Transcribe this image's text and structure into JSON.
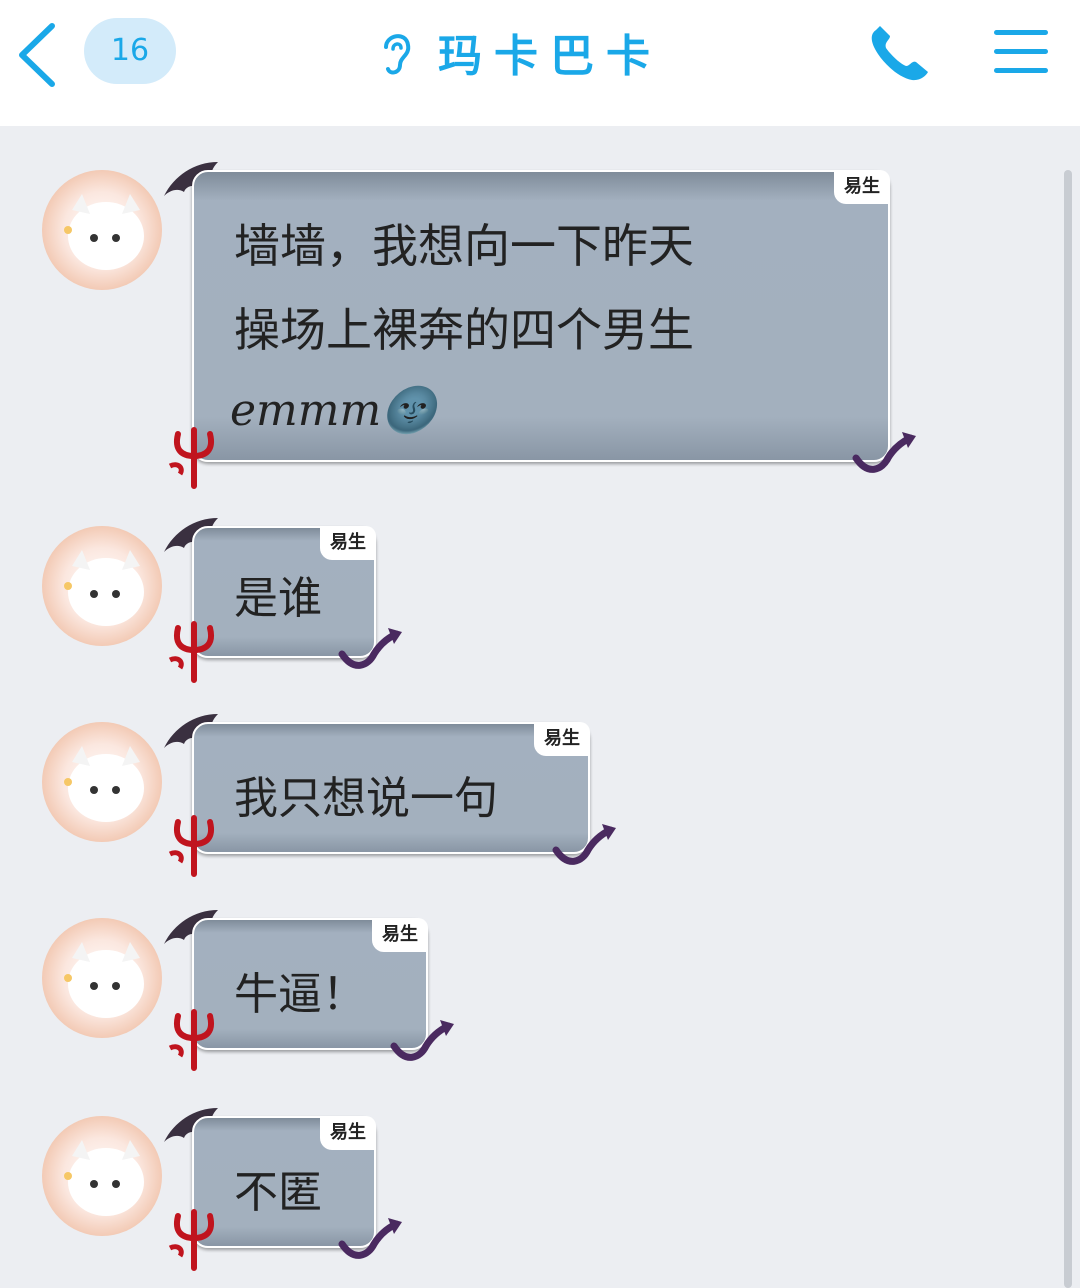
{
  "header": {
    "unread_count": "16",
    "title": "玛卡巴卡"
  },
  "messages": [
    {
      "lines": [
        "墙墙，我想向一下昨天",
        "操场上裸奔的四个男生",
        "emmm🌚"
      ],
      "tag": "易生"
    },
    {
      "lines": [
        "是谁"
      ],
      "tag": "易生"
    },
    {
      "lines": [
        "我只想说一句"
      ],
      "tag": "易生"
    },
    {
      "lines": [
        "牛逼！"
      ],
      "tag": "易生"
    },
    {
      "lines": [
        "不匿"
      ],
      "tag": "易生"
    }
  ],
  "colors": {
    "accent": "#1aa8e8",
    "badge_bg": "#d3ebfa",
    "bubble": "#a3b0bf",
    "background": "#eceef2"
  },
  "icons": [
    "back-chevron-icon",
    "ear-icon",
    "phone-icon",
    "menu-icon",
    "bat-wing-icon",
    "devil-trident-icon",
    "devil-tail-icon"
  ]
}
